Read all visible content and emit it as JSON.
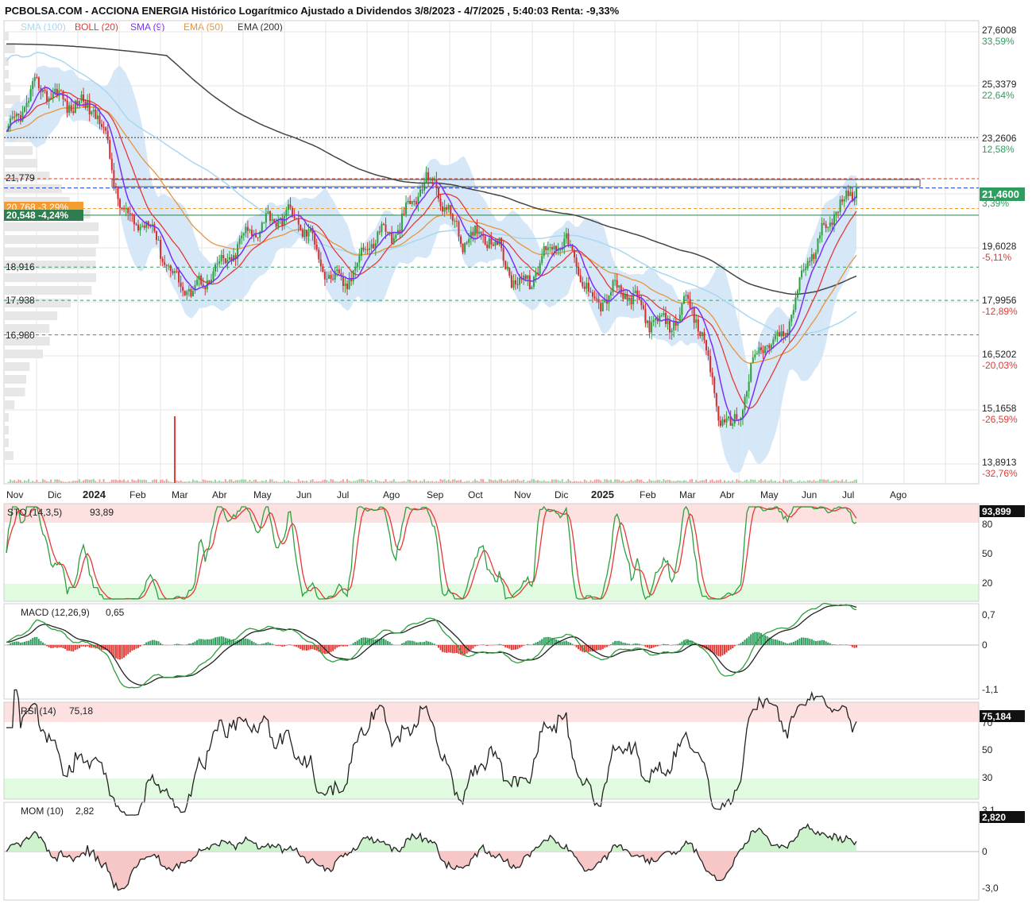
{
  "header": {
    "title": "PCBOLSA.COM - ACCIONA ENERGIA Histórico Logarítmico Ajustado a Dividendos 3/8/2023 - 4/7/2025 , 5:40:03 Renta: -9,33%"
  },
  "legend": [
    {
      "label": "SMA (100)",
      "color": "#a8d8f0"
    },
    {
      "label": "BOLL (20)",
      "color": "#e53935"
    },
    {
      "label": "SMA (9)",
      "color": "#7b2ff7"
    },
    {
      "label": "EMA (50)",
      "color": "#e8943a"
    },
    {
      "label": "EMA (200)",
      "color": "#333333"
    }
  ],
  "price_axis": [
    {
      "value": "27,6008",
      "pct": "33,59%",
      "pct_color": "#2e9e5e"
    },
    {
      "value": "25,3379",
      "pct": "22,64%",
      "pct_color": "#2e9e5e"
    },
    {
      "value": "23,2606",
      "pct": "12,58%",
      "pct_color": "#2e9e5e"
    },
    {
      "value": "",
      "pct": "3,39%",
      "pct_color": "#2e9e5e"
    },
    {
      "value": "19,6028",
      "pct": "-5,11%",
      "pct_color": "#e53935"
    },
    {
      "value": "17,9956",
      "pct": "-12,89%",
      "pct_color": "#e53935"
    },
    {
      "value": "16,5202",
      "pct": "-20,03%",
      "pct_color": "#e53935"
    },
    {
      "value": "15,1658",
      "pct": "-26,59%",
      "pct_color": "#e53935"
    },
    {
      "value": "13,8913",
      "pct": "-32,76%",
      "pct_color": "#e53935"
    }
  ],
  "left_levels": [
    "21,779",
    "18,916",
    "17,938",
    "16,980"
  ],
  "price_badges": {
    "last": "21,4600",
    "orange_badge": "20,768 -3,29%",
    "green_badge": "20,548 -4,24%"
  },
  "months": [
    "Nov",
    "Dic",
    "2024",
    "Feb",
    "Mar",
    "Abr",
    "May",
    "Jun",
    "Jul",
    "Ago",
    "Sep",
    "Oct",
    "Nov",
    "Dic",
    "2025",
    "Feb",
    "Mar",
    "Abr",
    "May",
    "Jun",
    "Jul",
    "Ago"
  ],
  "panels": {
    "sto": {
      "title": "STO (14,3,5)",
      "value": "93,89",
      "badge": "93,899",
      "levels": [
        "80",
        "50",
        "20"
      ]
    },
    "macd": {
      "title": "MACD (12,26,9)",
      "value": "0,65",
      "levels": [
        "0,7",
        "0",
        "-1,1"
      ]
    },
    "rsi": {
      "title": "RSI (14)",
      "value": "75,18",
      "badge": "75,184",
      "levels": [
        "70",
        "50",
        "30"
      ]
    },
    "mom": {
      "title": "MOM (10)",
      "value": "2,82",
      "badge": "2,820",
      "levels": [
        "3,1",
        "0",
        "-3,0"
      ]
    }
  },
  "colors": {
    "up": "#2e9e3e",
    "down": "#d32f2f",
    "band": "#cfe3f7",
    "grid": "#e6e6e6"
  },
  "chart_data": {
    "type": "line",
    "scale": "log",
    "ylim": [
      13.8913,
      27.6008
    ],
    "x": [
      "2023-11",
      "2023-12",
      "2024-01",
      "2024-02",
      "2024-03",
      "2024-04",
      "2024-05",
      "2024-06",
      "2024-07",
      "2024-08",
      "2024-09",
      "2024-10",
      "2024-11",
      "2024-12",
      "2025-01",
      "2025-02",
      "2025-03",
      "2025-04",
      "2025-05",
      "2025-06",
      "2025-07"
    ],
    "series": [
      {
        "name": "",
        "values": [
          23.3,
          25.4,
          24.0,
          20.5,
          18.6,
          18.6,
          20.6,
          20.0,
          18.4,
          20.3,
          21.3,
          19.9,
          18.7,
          19.4,
          18.2,
          17.6,
          17.5,
          14.9,
          16.6,
          19.4,
          21.46
        ]
      }
    ]
  }
}
